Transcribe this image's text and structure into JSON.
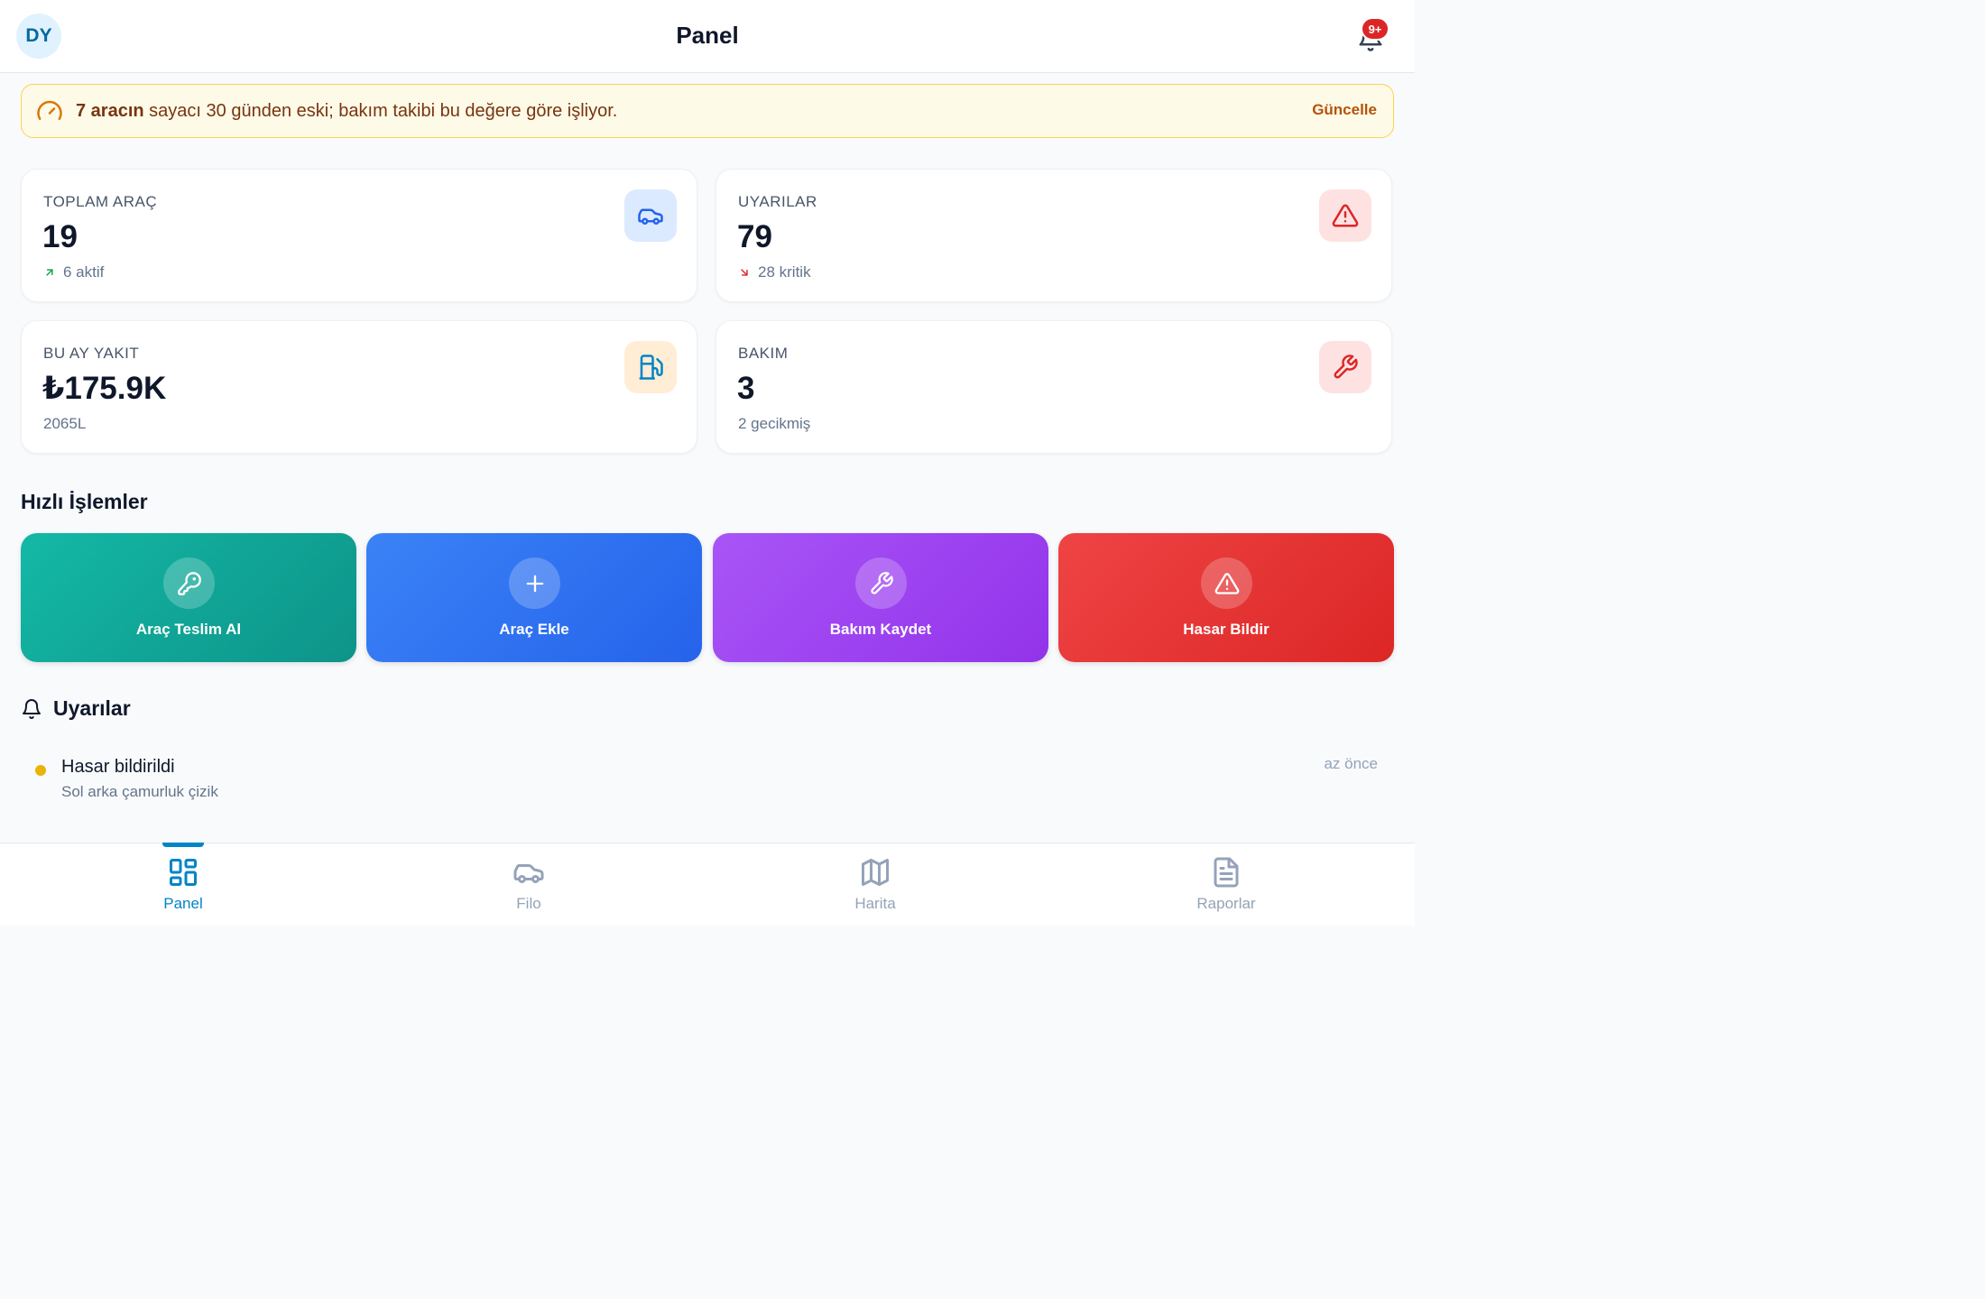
{
  "header": {
    "avatar_initials": "DY",
    "title": "Panel",
    "notification_count": "9+"
  },
  "banner": {
    "bold_text": "7 aracın",
    "text": " sayacı 30 günden eski; bakım takibi bu değere göre işliyor.",
    "action_label": "Güncelle"
  },
  "stats": {
    "vehicles": {
      "label": "TOPLAM ARAÇ",
      "value": "19",
      "sub": "6 aktif",
      "icon": "car-icon",
      "trend": "up"
    },
    "alerts": {
      "label": "UYARILAR",
      "value": "79",
      "sub": "28 kritik",
      "icon": "warning-icon",
      "trend": "down"
    },
    "fuel": {
      "label": "BU AY YAKIT",
      "value": "₺175.9K",
      "sub": "2065L",
      "icon": "fuel-icon"
    },
    "maintenance": {
      "label": "BAKIM",
      "value": "3",
      "sub": "2 gecikmiş",
      "icon": "wrench-icon"
    }
  },
  "quick_actions": {
    "title": "Hızlı İşlemler",
    "items": [
      {
        "label": "Araç Teslim Al",
        "icon": "key-icon",
        "color": "#14b8a6"
      },
      {
        "label": "Araç Ekle",
        "icon": "plus-icon",
        "color": "#3b82f6"
      },
      {
        "label": "Bakım Kaydet",
        "icon": "wrench-icon",
        "color": "#a855f7"
      },
      {
        "label": "Hasar Bildir",
        "icon": "warning-icon",
        "color": "#ef4444"
      }
    ]
  },
  "alerts_section": {
    "title": "Uyarılar",
    "items": [
      {
        "title": "Hasar bildirildi",
        "description": "Sol arka çamurluk çizik",
        "time": "az önce",
        "status_color": "#eab308"
      }
    ]
  },
  "bottom_nav": {
    "items": [
      {
        "label": "Panel",
        "icon": "dashboard-icon",
        "active": true
      },
      {
        "label": "Filo",
        "icon": "car-icon"
      },
      {
        "label": "Harita",
        "icon": "map-icon"
      },
      {
        "label": "Raporlar",
        "icon": "report-icon"
      }
    ]
  },
  "colors": {
    "accent": "#0284c7",
    "warning_bg": "#fefae8",
    "warning_border": "#fcd34d"
  }
}
